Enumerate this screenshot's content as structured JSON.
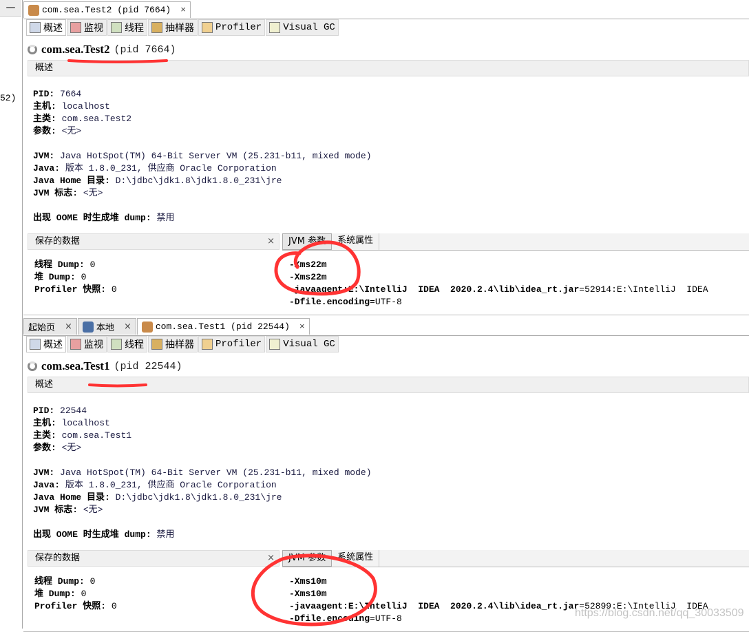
{
  "left_strip": {
    "minimize_label": "—",
    "fragment_text": "52)"
  },
  "panels": [
    {
      "doc_tabs": [
        {
          "label": "com.sea.Test2 (pid 7664)",
          "active": true
        }
      ],
      "sub_tabs": [
        "概述",
        "监视",
        "线程",
        "抽样器",
        "Profiler",
        "Visual GC"
      ],
      "title_class": "com.sea.Test2",
      "title_pid": "(pid 7664)",
      "section_header": "概述",
      "info": {
        "pid_label": "PID:",
        "pid": "7664",
        "host_label": "主机:",
        "host": "localhost",
        "main_class_label": "主类:",
        "main_class": "com.sea.Test2",
        "args_label": "参数:",
        "args": "<无>",
        "jvm_label": "JVM:",
        "jvm": "Java HotSpot(TM) 64-Bit Server VM (25.231-b11, mixed mode)",
        "java_label": "Java:",
        "java": "版本 1.8.0_231, 供应商 Oracle Corporation",
        "java_home_label": "Java Home 目录:",
        "java_home": "D:\\jdbc\\jdk1.8\\jdk1.8.0_231\\jre",
        "jvm_flags_label": "JVM 标志:",
        "jvm_flags": "<无>",
        "oome_label": "出现 OOME 时生成堆 dump:",
        "oome": "禁用"
      },
      "saved_data": {
        "header": "保存的数据",
        "close": "×",
        "thread_dump_label": "线程 Dump:",
        "thread_dump": "0",
        "heap_dump_label": "堆 Dump:",
        "heap_dump": "0",
        "profiler_label": "Profiler 快照:",
        "profiler": "0"
      },
      "jvm_tabs": [
        "JVM 参数",
        "系统属性"
      ],
      "jvm_args": {
        "arg1": "-Xms22m",
        "arg2": "-Xms22m",
        "arg3_key": "-javaagent:E:\\IntelliJ  IDEA  2020.2.4\\lib\\idea_rt.jar",
        "arg3_val": "=52914:E:\\IntelliJ  IDEA",
        "arg4_key": "-Dfile.encoding",
        "arg4_val": "=UTF-8"
      }
    },
    {
      "doc_tabs": [
        {
          "label": "起始页",
          "active": false
        },
        {
          "label": "本地",
          "active": false
        },
        {
          "label": "com.sea.Test1 (pid 22544)",
          "active": true
        }
      ],
      "sub_tabs": [
        "概述",
        "监视",
        "线程",
        "抽样器",
        "Profiler",
        "Visual GC"
      ],
      "title_class": "com.sea.Test1",
      "title_pid": "(pid 22544)",
      "section_header": "概述",
      "info": {
        "pid_label": "PID:",
        "pid": "22544",
        "host_label": "主机:",
        "host": "localhost",
        "main_class_label": "主类:",
        "main_class": "com.sea.Test1",
        "args_label": "参数:",
        "args": "<无>",
        "jvm_label": "JVM:",
        "jvm": "Java HotSpot(TM) 64-Bit Server VM (25.231-b11, mixed mode)",
        "java_label": "Java:",
        "java": "版本 1.8.0_231, 供应商 Oracle Corporation",
        "java_home_label": "Java Home 目录:",
        "java_home": "D:\\jdbc\\jdk1.8\\jdk1.8.0_231\\jre",
        "jvm_flags_label": "JVM 标志:",
        "jvm_flags": "<无>",
        "oome_label": "出现 OOME 时生成堆 dump:",
        "oome": "禁用"
      },
      "saved_data": {
        "header": "保存的数据",
        "close": "×",
        "thread_dump_label": "线程 Dump:",
        "thread_dump": "0",
        "heap_dump_label": "堆 Dump:",
        "heap_dump": "0",
        "profiler_label": "Profiler 快照:",
        "profiler": "0"
      },
      "jvm_tabs": [
        "JVM 参数",
        "系统属性"
      ],
      "jvm_args": {
        "arg1": "-Xms10m",
        "arg2": "-Xms10m",
        "arg3_key": "-javaagent:E:\\IntelliJ  IDEA  2020.2.4\\lib\\idea_rt.jar",
        "arg3_val": "=52899:E:\\IntelliJ  IDEA",
        "arg4_key": "-Dfile.encoding",
        "arg4_val": "=UTF-8"
      }
    }
  ],
  "close_glyph": "×",
  "annotation_color": "#ff3333",
  "watermark": "https://blog.csdn.net/qq_30033509"
}
